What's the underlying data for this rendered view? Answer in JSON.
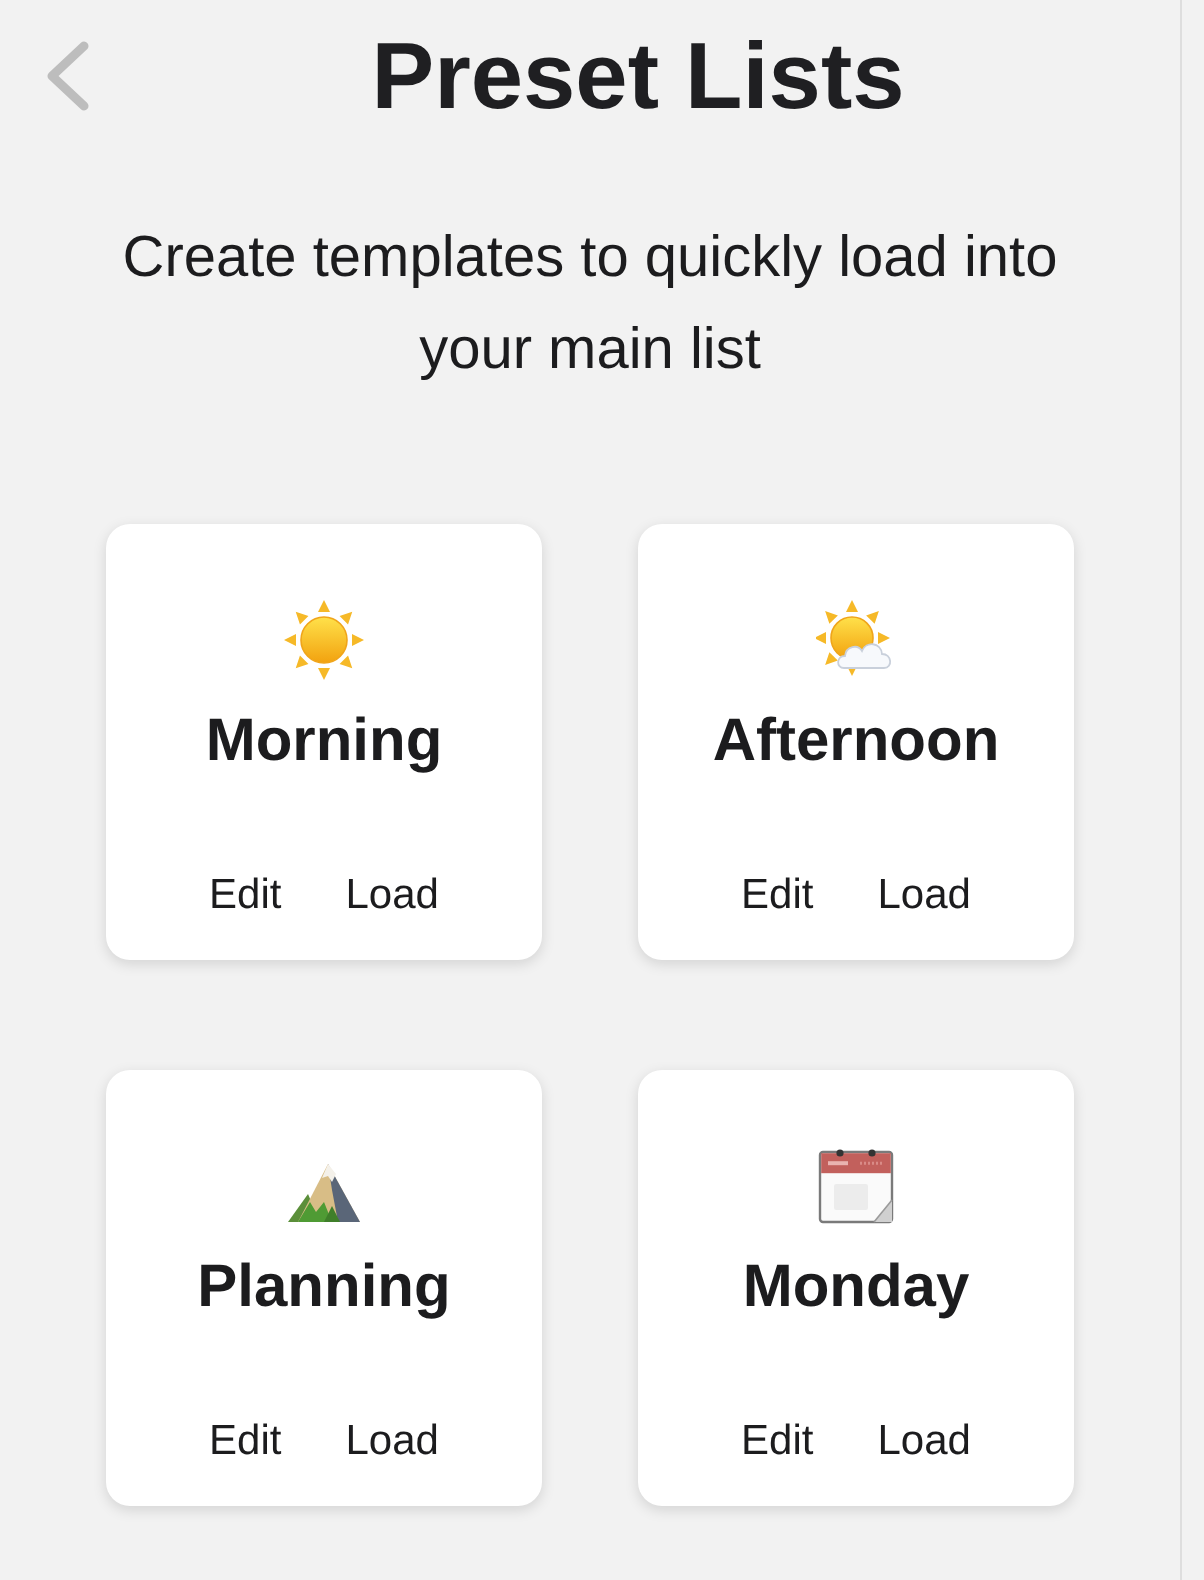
{
  "title": "Preset Lists",
  "subtitle": "Create templates to quickly load into your main list",
  "presets": [
    {
      "kind": "sun",
      "name": "Morning",
      "actions": [
        "Edit",
        "Load"
      ]
    },
    {
      "kind": "cloud",
      "name": "Afternoon",
      "actions": [
        "Edit",
        "Load"
      ]
    },
    {
      "kind": "mountain",
      "name": "Planning",
      "actions": [
        "Edit",
        "Load"
      ]
    },
    {
      "kind": "calendar",
      "name": "Monday",
      "actions": [
        "Edit",
        "Load"
      ]
    }
  ]
}
